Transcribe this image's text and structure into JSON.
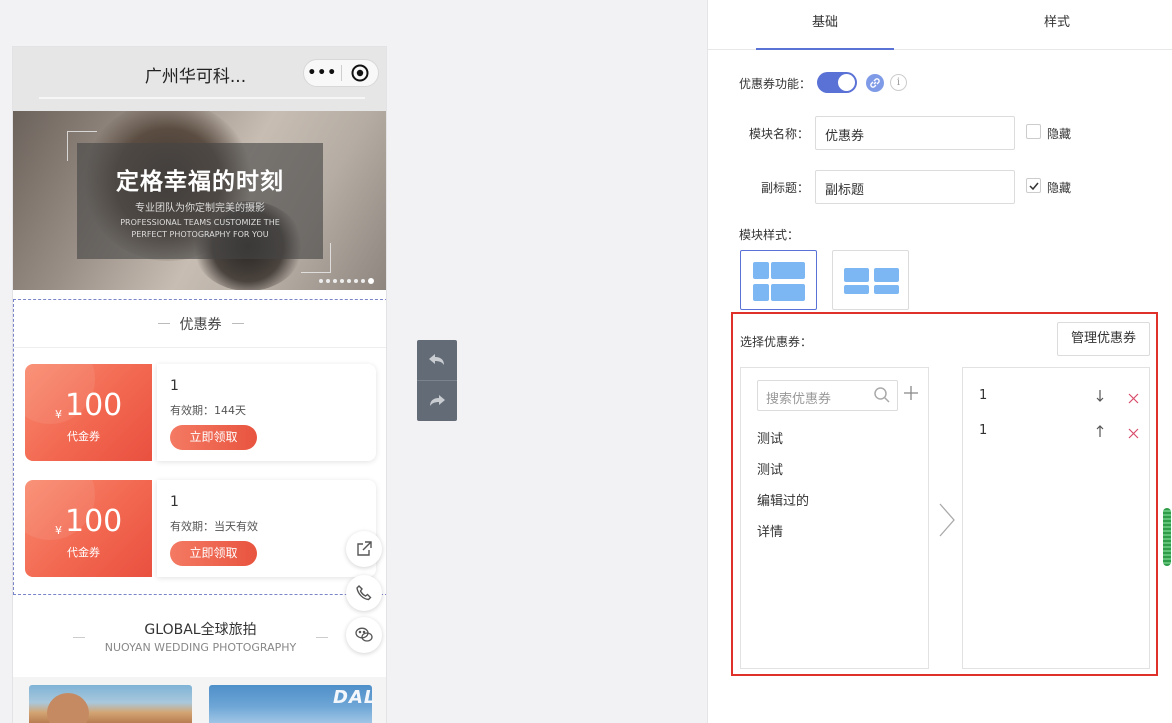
{
  "phone": {
    "title": "广州华可科...",
    "capsule_more": "•••",
    "banner": {
      "title": "定格幸福的时刻",
      "subtitle": "专业团队为你定制完美的摄影",
      "english_line1": "PROFESSIONAL TEAMS CUSTOMIZE THE",
      "english_line2": "PERFECT PHOTOGRAPHY FOR YOU"
    },
    "coupon_module_title": "优惠券",
    "coupons": [
      {
        "currency": "¥",
        "amount": "100",
        "kind": "代金券",
        "name": "1",
        "expiry": "有效期：144天",
        "button": "立即领取"
      },
      {
        "currency": "¥",
        "amount": "100",
        "kind": "代金券",
        "name": "1",
        "expiry": "有效期：当天有效",
        "button": "立即领取"
      }
    ],
    "global": {
      "title": "GLOBAL全球旅拍",
      "subtitle": "NUOYAN WEDDING PHOTOGRAPHY"
    },
    "gallery_word": "DAL"
  },
  "panel": {
    "tabs": [
      "基础",
      "样式"
    ],
    "coupon_feature_label": "优惠券功能：",
    "module_name_label": "模块名称：",
    "module_name_value": "优惠券",
    "hide_label": "隐藏",
    "subtitle_label": "副标题：",
    "subtitle_value": "副标题",
    "module_style_label": "模块样式：",
    "select_coupon_label": "选择优惠券：",
    "manage_button": "管理优惠券",
    "search_placeholder": "搜索优惠券",
    "available": [
      "测试",
      "测试",
      "编辑过的",
      "详情"
    ],
    "selected": [
      "1",
      "1"
    ]
  },
  "colors": {
    "accent": "#5a71d6",
    "coupon_red": "#f26750",
    "highlight_border": "#e0302a"
  }
}
